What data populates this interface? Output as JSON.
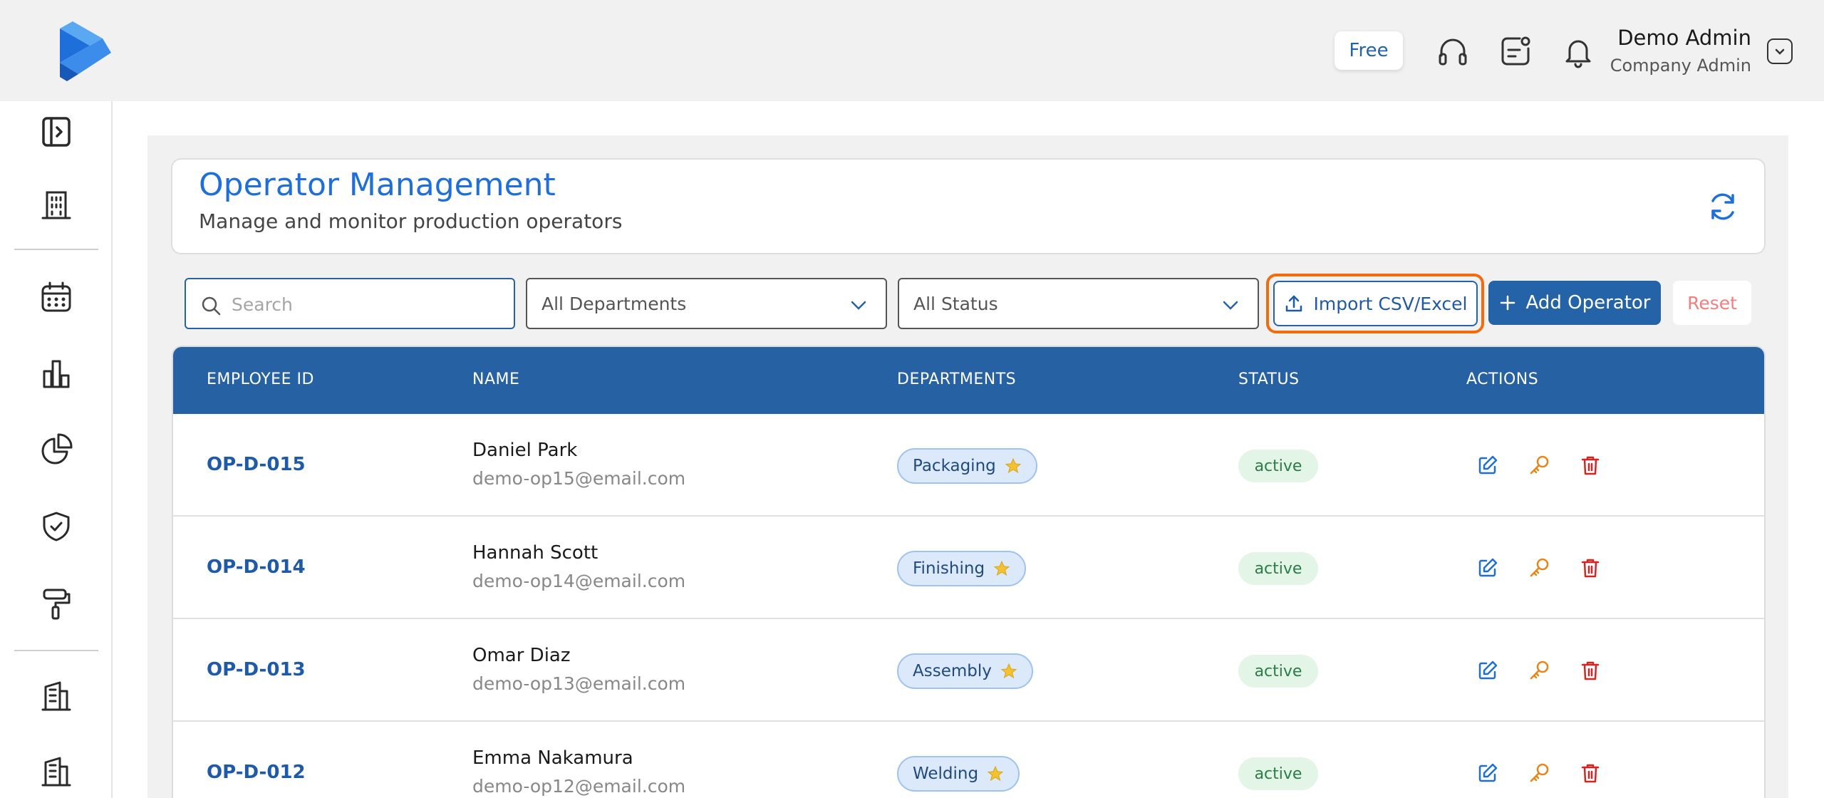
{
  "header": {
    "plan_badge": "Free",
    "user_name": "Demo Admin",
    "user_role": "Company Admin",
    "icons": [
      "headset-icon",
      "notes-icon",
      "bell-icon",
      "chevron-down-icon"
    ]
  },
  "sidebar": {
    "icons": [
      "sidebar-toggle-icon",
      "building-icon",
      "calendar-icon",
      "bar-chart-icon",
      "pie-chart-icon",
      "shield-check-icon",
      "paint-roller-icon",
      "office-building-icon",
      "office-building-alt-icon"
    ]
  },
  "page": {
    "title": "Operator Management",
    "subtitle": "Manage and monitor production operators"
  },
  "filters": {
    "search_placeholder": "Search",
    "department_selected": "All Departments",
    "status_selected": "All Status"
  },
  "toolbar": {
    "import_label": "Import CSV/Excel",
    "add_label": "Add Operator",
    "reset_label": "Reset"
  },
  "table": {
    "columns": [
      "EMPLOYEE ID",
      "NAME",
      "DEPARTMENTS",
      "STATUS",
      "ACTIONS"
    ],
    "rows": [
      {
        "id": "OP-D-015",
        "name": "Daniel Park",
        "email": "demo-op15@email.com",
        "department": "Packaging",
        "status": "active"
      },
      {
        "id": "OP-D-014",
        "name": "Hannah Scott",
        "email": "demo-op14@email.com",
        "department": "Finishing",
        "status": "active"
      },
      {
        "id": "OP-D-013",
        "name": "Omar Diaz",
        "email": "demo-op13@email.com",
        "department": "Assembly",
        "status": "active"
      },
      {
        "id": "OP-D-012",
        "name": "Emma Nakamura",
        "email": "demo-op12@email.com",
        "department": "Welding",
        "status": "active"
      }
    ]
  },
  "colors": {
    "primary": "#2563a8",
    "title_blue": "#1e6fd9",
    "highlight_orange": "#f26b0f",
    "edit_blue": "#1f6fd1",
    "key_orange": "#e8861a",
    "delete_red": "#d92323"
  }
}
